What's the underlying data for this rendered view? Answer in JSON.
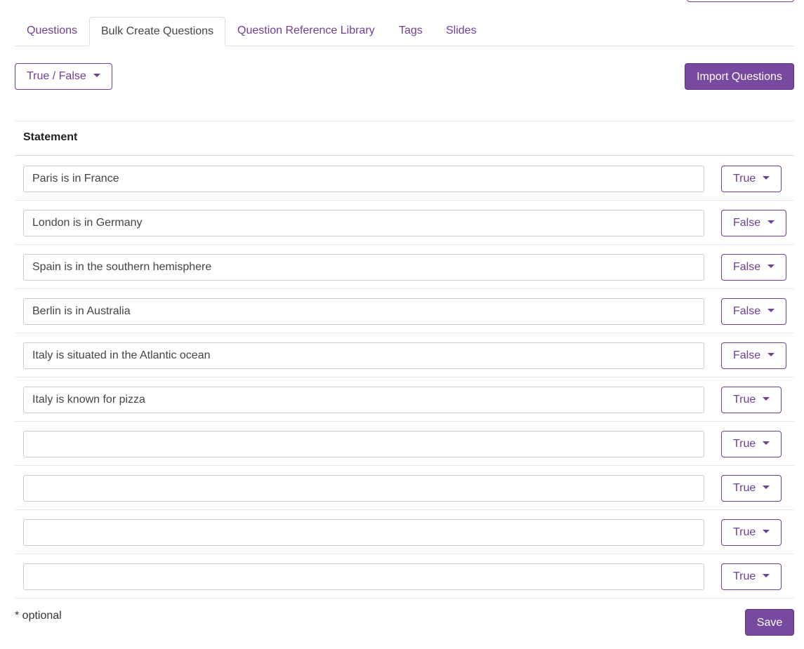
{
  "tabs": [
    {
      "label": "Questions",
      "active": false
    },
    {
      "label": "Bulk Create Questions",
      "active": true
    },
    {
      "label": "Question Reference Library",
      "active": false
    },
    {
      "label": "Tags",
      "active": false
    },
    {
      "label": "Slides",
      "active": false
    }
  ],
  "question_type": {
    "label": "True / False"
  },
  "import_button": {
    "label": "Import Questions"
  },
  "table": {
    "header": "Statement",
    "rows": [
      {
        "statement": "Paris is in France",
        "answer": "True"
      },
      {
        "statement": "London is in Germany",
        "answer": "False"
      },
      {
        "statement": "Spain is in the southern hemisphere",
        "answer": "False"
      },
      {
        "statement": "Berlin is in Australia",
        "answer": "False"
      },
      {
        "statement": "Italy is situated in the Atlantic ocean",
        "answer": "False"
      },
      {
        "statement": "Italy is known for pizza",
        "answer": "True"
      },
      {
        "statement": "",
        "answer": "True"
      },
      {
        "statement": "",
        "answer": "True"
      },
      {
        "statement": "",
        "answer": "True"
      },
      {
        "statement": "",
        "answer": "True"
      }
    ]
  },
  "footer": {
    "optional_note": "* optional",
    "save_label": "Save"
  },
  "colors": {
    "accent": "#6f3f93",
    "primary_button": "#774a9f"
  }
}
